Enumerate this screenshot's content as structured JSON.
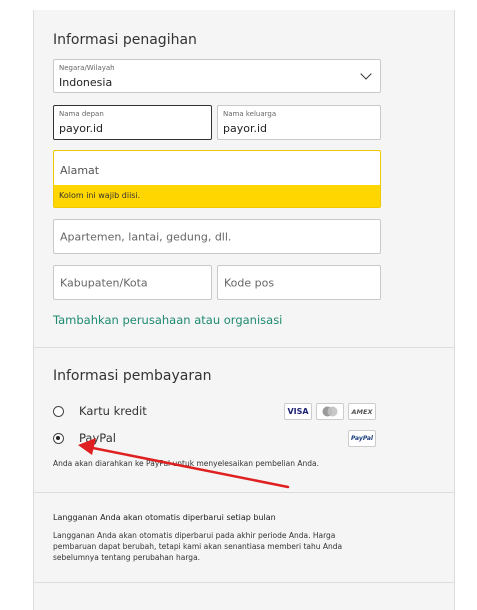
{
  "billing": {
    "title": "Informasi penagihan",
    "country_label": "Negara/Wilayah",
    "country_value": "Indonesia",
    "first_name_label": "Nama depan",
    "first_name_value": "payor.id",
    "last_name_label": "Nama keluarga",
    "last_name_value": "payor.id",
    "address_placeholder": "Alamat",
    "address_error": "Kolom ini wajib diisi.",
    "address2_placeholder": "Apartemen, lantai, gedung, dll.",
    "city_placeholder": "Kabupaten/Kota",
    "postal_placeholder": "Kode pos",
    "add_company_link": "Tambahkan perusahaan atau organisasi"
  },
  "payment": {
    "title": "Informasi pembayaran",
    "options": [
      {
        "label": "Kartu kredit",
        "selected": false
      },
      {
        "label": "PayPal",
        "selected": true
      }
    ],
    "card_brands": [
      "VISA",
      "AMEX"
    ],
    "paypal_badge": "PayPal",
    "paypal_note": "Anda akan diarahkan ke PayPal untuk menyelesaikan pembelian Anda."
  },
  "renewal": {
    "title": "Langganan Anda akan otomatis diperbarui setiap bulan",
    "lines": [
      "Langganan Anda akan otomatis diperbarui pada akhir periode Anda. Harga",
      "pembaruan dapat berubah, tetapi kami akan senantiasa memberi tahu Anda",
      "sebelumnya tentang perubahan harga."
    ]
  },
  "colors": {
    "link": "#1f8a70",
    "error_bg": "#ffd600",
    "arrow": "#e02020"
  }
}
